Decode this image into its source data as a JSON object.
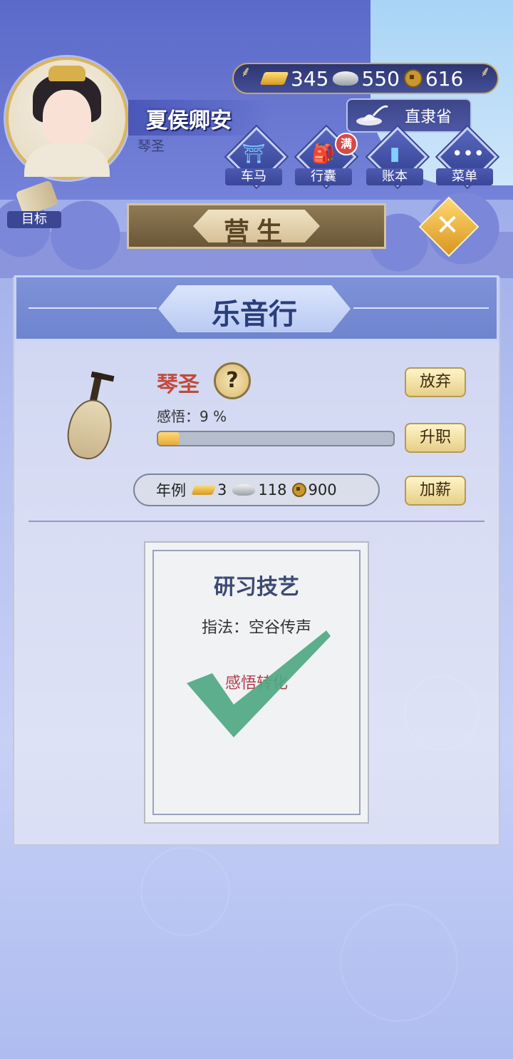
{
  "player": {
    "name": "夏侯卿安",
    "title": "琴圣"
  },
  "currency": {
    "gold": "345",
    "silver": "550",
    "copper": "616"
  },
  "province": {
    "label": "直隶省"
  },
  "menu": [
    {
      "label": "车马",
      "icon": "carriage-icon"
    },
    {
      "label": "行囊",
      "icon": "bag-icon",
      "badge": "满"
    },
    {
      "label": "账本",
      "icon": "ledger-icon"
    },
    {
      "label": "菜单",
      "icon": "more-icon"
    }
  ],
  "goal": {
    "label": "目标"
  },
  "banner": {
    "title": "营生"
  },
  "panel": {
    "title": "乐音行",
    "job": "琴圣",
    "help": "?",
    "insight_label": "感悟：9 %",
    "insight_progress": 0.09,
    "buttons": {
      "abandon": "放弃",
      "promote": "升职",
      "raise": "加薪"
    },
    "salary": {
      "label": "年例",
      "gold": "3",
      "silver": "118",
      "copper": "900"
    }
  },
  "card": {
    "title": "研习技艺",
    "skill": "指法：空谷传声",
    "insight": "感悟转化"
  },
  "colors": {
    "accent": "#5b69c9",
    "gold": "#d8b04a",
    "job_red": "#c24a3a",
    "check_green": "#4fa882"
  }
}
